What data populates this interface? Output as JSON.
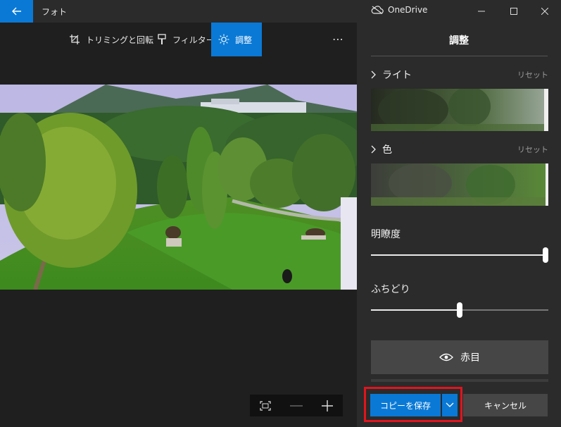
{
  "titlebar": {
    "app_title": "フォト",
    "onedrive_label": "OneDrive",
    "icons": [
      "back-arrow-icon",
      "cloud-icon",
      "minimize-icon",
      "maximize-icon",
      "close-icon"
    ]
  },
  "toolbar": {
    "tools": [
      {
        "label": "トリミングと回転",
        "icon": "crop-rotate-icon"
      },
      {
        "label": "フィルター",
        "icon": "filter-brush-icon"
      },
      {
        "label": "調整",
        "icon": "brightness-icon",
        "active": true
      }
    ],
    "more_label": "⋯"
  },
  "panel": {
    "title": "調整",
    "sections": [
      {
        "label": "ライト",
        "reset": "リセット"
      },
      {
        "label": "色",
        "reset": "リセット"
      }
    ],
    "sliders": [
      {
        "label": "明瞭度",
        "value": 1.0
      },
      {
        "label": "ふちどり",
        "value": 0.5
      }
    ],
    "redeye_label": "赤目"
  },
  "actions": {
    "save_copy": "コピーを保存",
    "cancel": "キャンセル"
  },
  "colors": {
    "accent": "#0a79d6",
    "highlight_border": "#e0141e",
    "panel_bg": "#2b2b2b",
    "canvas_bg": "#1f1f1f"
  }
}
